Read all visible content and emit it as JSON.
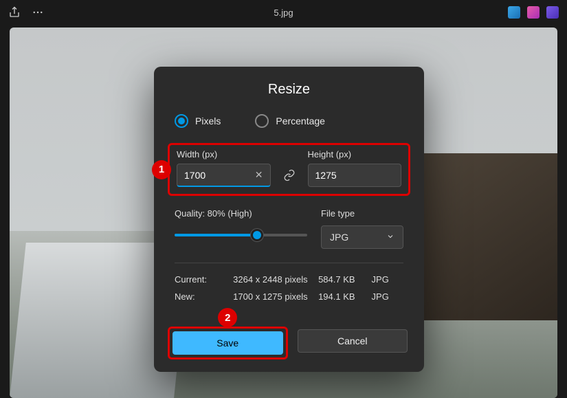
{
  "topbar": {
    "title": "5.jpg"
  },
  "dialog": {
    "title": "Resize",
    "radio": {
      "pixels": "Pixels",
      "percentage": "Percentage"
    },
    "width_label": "Width  (px)",
    "height_label": "Height  (px)",
    "width_value": "1700",
    "height_value": "1275",
    "quality_label": "Quality: 80% (High)",
    "filetype_label": "File type",
    "filetype_value": "JPG",
    "info": {
      "current_label": "Current:",
      "new_label": "New:",
      "current_dim": "3264 x 2448 pixels",
      "new_dim": "1700 x 1275 pixels",
      "current_size": "584.7 KB",
      "new_size": "194.1 KB",
      "current_type": "JPG",
      "new_type": "JPG"
    },
    "save": "Save",
    "cancel": "Cancel"
  },
  "annotations": {
    "one": "1",
    "two": "2"
  }
}
